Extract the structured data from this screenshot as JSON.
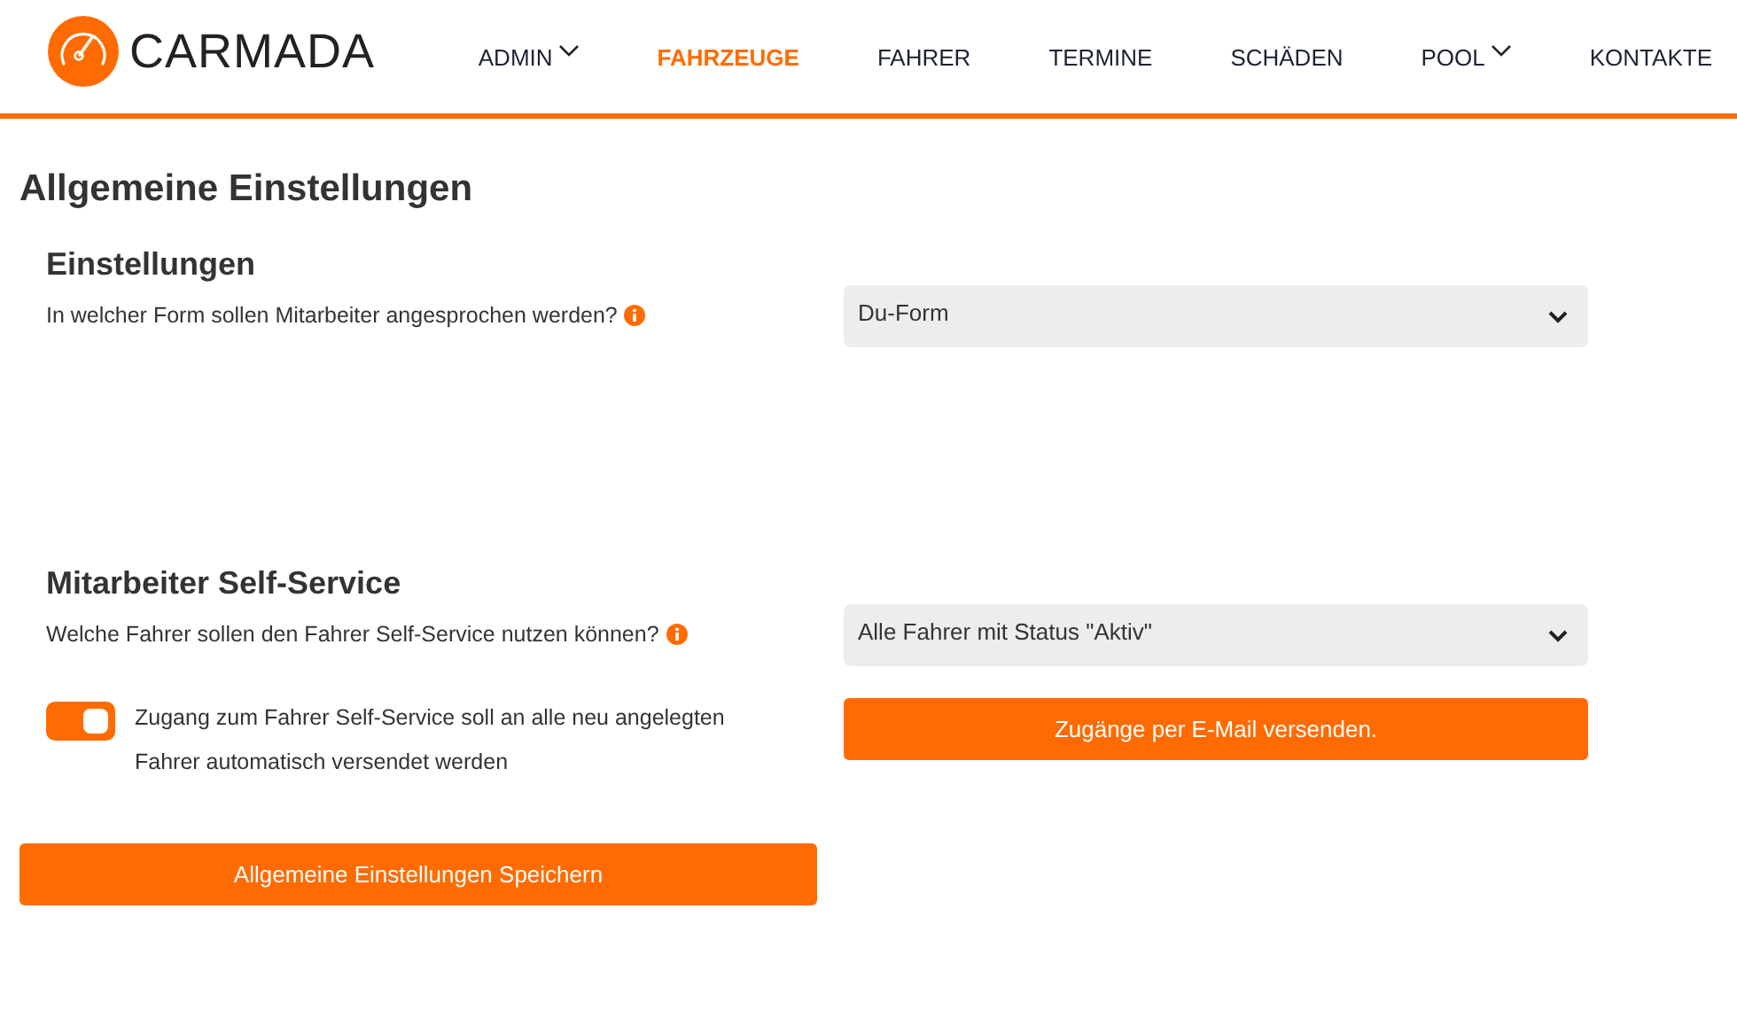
{
  "brand": {
    "name": "CARMADA"
  },
  "nav": [
    {
      "label": "ADMIN",
      "dropdown": true,
      "selected": false
    },
    {
      "label": "FAHRZEUGE",
      "dropdown": false,
      "selected": true
    },
    {
      "label": "FAHRER",
      "dropdown": false,
      "selected": false
    },
    {
      "label": "TERMINE",
      "dropdown": false,
      "selected": false
    },
    {
      "label": "SCHÄDEN",
      "dropdown": false,
      "selected": false
    },
    {
      "label": "POOL",
      "dropdown": true,
      "selected": false
    },
    {
      "label": "KONTAKTE",
      "dropdown": false,
      "selected": false
    }
  ],
  "page_title": "Allgemeine Einstellungen",
  "sections": [
    {
      "title": "Einstellungen",
      "question": "In welcher Form sollen Mitarbeiter angesprochen werden?",
      "select_value": "Du-Form"
    },
    {
      "title": "Mitarbeiter Self-Service",
      "question": "Welche Fahrer sollen den Fahrer Self-Service nutzen können?",
      "select_value": "Alle Fahrer mit Status \"Aktiv\""
    }
  ],
  "toggle": {
    "on": true,
    "label": "Zugang zum Fahrer Self-Service soll an alle neu angelegten Fahrer automatisch versendet werden"
  },
  "send_button": "Zugänge per E-Mail versenden.",
  "save_button": "Allgemeine Einstellungen Speichern"
}
